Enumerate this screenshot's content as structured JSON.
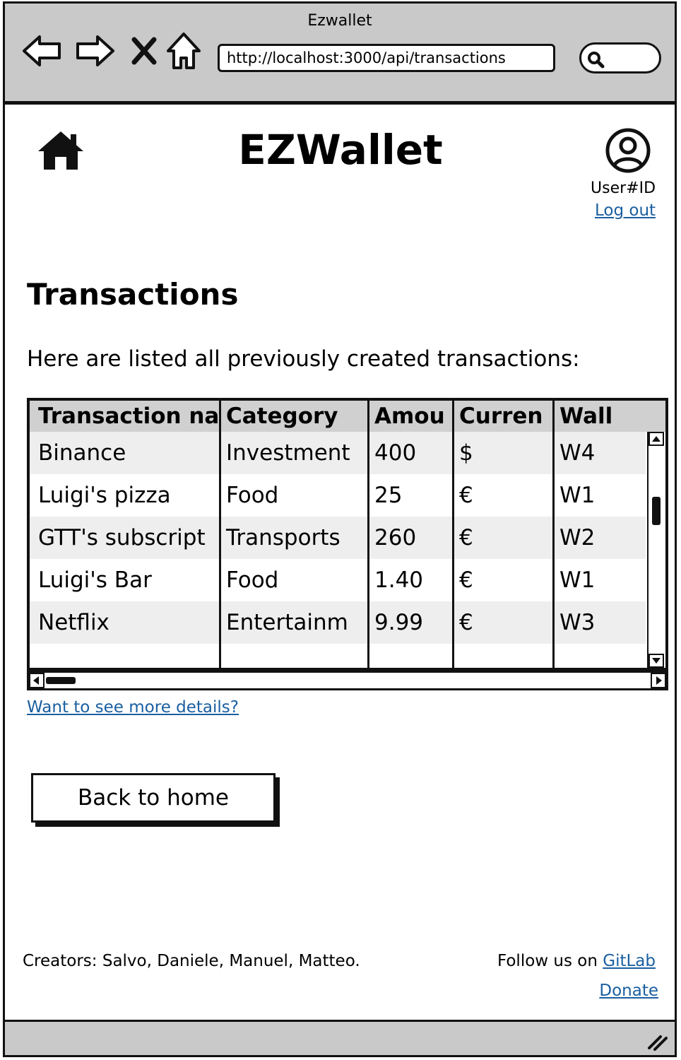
{
  "browser": {
    "window_title": "Ezwallet",
    "url": "http://localhost:3000/api/transactions"
  },
  "header": {
    "app_title": "EZWallet",
    "user_id": "User#ID",
    "logout_label": "Log out"
  },
  "main": {
    "section_title": "Transactions",
    "intro_text": "Here are listed all previously created transactions:",
    "table": {
      "columns": [
        "Transaction na",
        "Category",
        "Amou",
        "Curren",
        "Wall"
      ],
      "rows": [
        [
          "Binance",
          "Investment",
          "400",
          "$",
          "W4"
        ],
        [
          "Luigi's pizza",
          "Food",
          "25",
          "€",
          "W1"
        ],
        [
          "GTT's subscript",
          "Transports",
          "260",
          "€",
          "W2"
        ],
        [
          "Luigi's Bar",
          "Food",
          "1.40",
          "€",
          "W1"
        ],
        [
          "Netflix",
          "Entertainm",
          "9.99",
          "€",
          "W3"
        ]
      ]
    },
    "details_link": "Want to see more details?",
    "back_button": "Back to home"
  },
  "footer": {
    "creators": "Creators: Salvo, Daniele, Manuel, Matteo.",
    "follow_text": "Follow us on ",
    "gitlab_link": "GitLab",
    "donate_link": "Donate"
  },
  "icons": [
    "back-icon",
    "forward-icon",
    "close-icon",
    "home-nav-icon",
    "search-icon",
    "home-icon",
    "user-icon",
    "resize-grip-icon"
  ]
}
